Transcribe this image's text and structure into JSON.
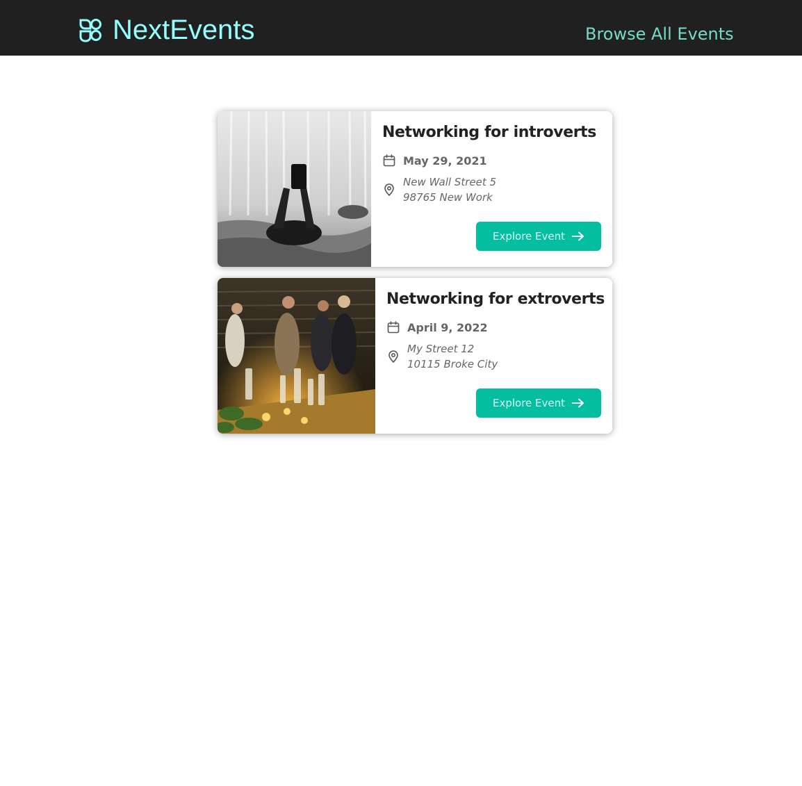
{
  "header": {
    "logo_text": "NextEvents",
    "nav_link": "Browse All Events"
  },
  "colors": {
    "header_bg": "#202020",
    "logo": "#94fdfd",
    "nav_link": "#74dacc",
    "button": "#03be9f"
  },
  "events": [
    {
      "title": "Networking for introverts",
      "date": "May 29, 2021",
      "address_line1": "New Wall Street 5",
      "address_line2": "98765 New Work",
      "button_label": "Explore Event",
      "image_desc": "black and white photo of person lying on a bed holding up a phone"
    },
    {
      "title": "Networking for extroverts",
      "date": "April 9, 2022",
      "address_line1": "My Street 12",
      "address_line2": "10115 Broke City",
      "button_label": "Explore Event",
      "image_desc": "warm-lit party with people talking around a table with bottles and candles"
    }
  ],
  "icons": [
    "logo-icon",
    "calendar-icon",
    "location-pin-icon",
    "arrow-right-icon"
  ]
}
